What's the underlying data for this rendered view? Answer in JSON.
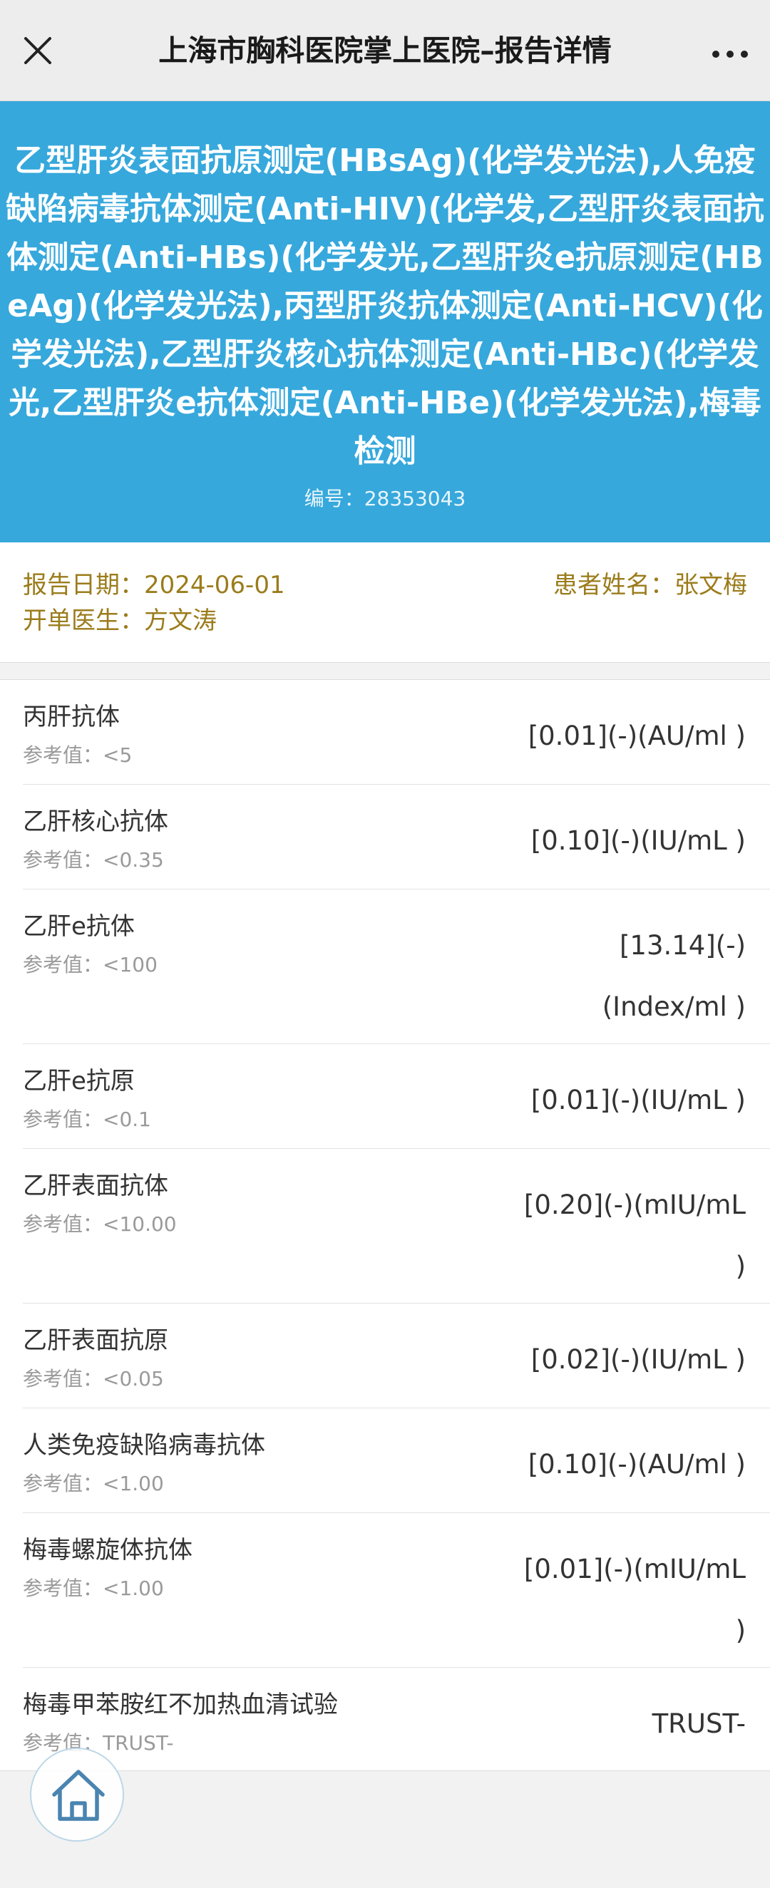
{
  "nav": {
    "title": "上海市胸科医院掌上医院–报告详情",
    "close_icon": "close-icon",
    "more_icon": "more-dots-icon"
  },
  "banner": {
    "title": "乙型肝炎表面抗原测定(HBsAg)(化学发光法),人免疫缺陷病毒抗体测定(Anti-HIV)(化学发,乙型肝炎表面抗体测定(Anti-HBs)(化学发光,乙型肝炎e抗原测定(HBeAg)(化学发光法),丙型肝炎抗体测定(Anti-HCV)(化学发光法),乙型肝炎核心抗体测定(Anti-HBc)(化学发光,乙型肝炎e抗体测定(Anti-HBe)(化学发光法),梅毒检测",
    "code": "编号：28353043",
    "color": "#36a8dc"
  },
  "info": {
    "report_date": "报告日期：2024-06-01",
    "patient_name": "患者姓名：张文梅",
    "doctor": "开单医生：方文涛",
    "color": "#9b7c1c"
  },
  "results": [
    {
      "name": "丙肝抗体",
      "ref": "参考值：<5",
      "value": "[0.01](-)(AU/ml )"
    },
    {
      "name": "乙肝核心抗体",
      "ref": "参考值：<0.35",
      "value": "[0.10](-)(IU/mL )"
    },
    {
      "name": "乙肝e抗体",
      "ref": "参考值：<100",
      "value": "[13.14](-)(Index/ml )"
    },
    {
      "name": "乙肝e抗原",
      "ref": "参考值：<0.1",
      "value": "[0.01](-)(IU/mL )"
    },
    {
      "name": "乙肝表面抗体",
      "ref": "参考值：<10.00",
      "value": "[0.20](-)(mIU/mL )"
    },
    {
      "name": "乙肝表面抗原",
      "ref": "参考值：<0.05",
      "value": "[0.02](-)(IU/mL )"
    },
    {
      "name": "人类免疫缺陷病毒抗体",
      "ref": "参考值：<1.00",
      "value": "[0.10](-)(AU/ml )"
    },
    {
      "name": "梅毒螺旋体抗体",
      "ref": "参考值：<1.00",
      "value": "[0.01](-)(mIU/mL )"
    },
    {
      "name": "梅毒甲苯胺红不加热血清试验",
      "ref": "参考值：TRUST-",
      "value": "TRUST-"
    }
  ],
  "home": {
    "icon": "home-icon"
  }
}
